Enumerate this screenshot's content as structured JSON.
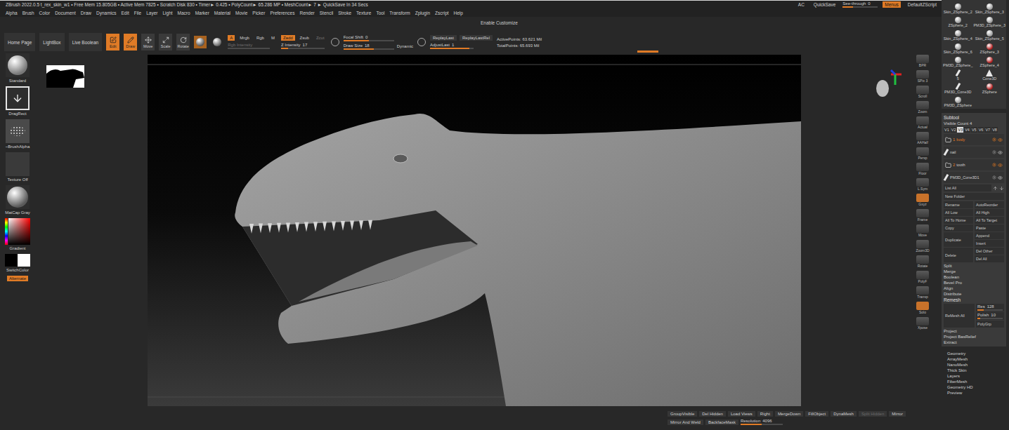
{
  "title_bar": {
    "text": "ZBrush 2022.0.5  t_rex_skin_w1  • Free Mem 15.805GB • Active Mem 7825 • Scratch Disk 830 • Timer► 0.425 • PolyCount► 65.286 MP • MeshCount► 7 ► QuickSave In 34 Secs"
  },
  "quick_bar": {
    "ac": "AC",
    "quicksave": "QuickSave",
    "see_through": {
      "label": "See-through",
      "value": "0",
      "level": 0.3
    },
    "menus": {
      "label": "Menus",
      "selected": true
    },
    "script": "DefaultZScript"
  },
  "menu": [
    "Alpha",
    "Brush",
    "Color",
    "Document",
    "Draw",
    "Dynamics",
    "Edit",
    "File",
    "Layer",
    "Light",
    "Macro",
    "Marker",
    "Material",
    "Movie",
    "Picker",
    "Preferences",
    "Render",
    "Stencil",
    "Stroke",
    "Texture",
    "Tool",
    "Transform",
    "Zplugin",
    "Zscript",
    "Help"
  ],
  "customize": "Enable Customize",
  "top_shelf": {
    "nav": [
      "Home Page",
      "LightBox",
      "Live Boolean"
    ],
    "modes": [
      {
        "label": "Edit",
        "selected": true
      },
      {
        "label": "Draw",
        "selected": true
      },
      {
        "label": "Move",
        "selected": false
      },
      {
        "label": "Scale",
        "selected": false
      },
      {
        "label": "Rotate",
        "selected": false
      }
    ],
    "color_modes": [
      {
        "label": "A",
        "selected": true
      },
      {
        "label": "Mrgb",
        "selected": false
      },
      {
        "label": "Rgb",
        "selected": false
      },
      {
        "label": "M",
        "selected": false
      }
    ],
    "rgb_intensity": {
      "label": "Rgb Intensity",
      "value": "",
      "level": 0,
      "disabled": true
    },
    "z_modes": [
      {
        "label": "Zadd",
        "selected": true,
        "disabled": false
      },
      {
        "label": "Zsub",
        "selected": false,
        "disabled": false
      },
      {
        "label": "Zcut",
        "selected": false,
        "disabled": true
      }
    ],
    "z_intensity": {
      "label": "Z Intensity",
      "value": "17",
      "level": 0.17
    },
    "focal_shift": {
      "label": "Focal Shift",
      "value": "0",
      "level": 0.5
    },
    "draw_size": {
      "label": "Draw Size",
      "value": "18",
      "level": 0.6
    },
    "dynamic": "Dynamic",
    "replay": [
      "ReplayLast",
      "ReplayLastRel"
    ],
    "adjust_last": {
      "label": "AdjustLast",
      "value": "1",
      "level": 0.9
    },
    "points": [
      "ActivePoints: 63.621 Mil",
      "TotalPoints: 65.693 Mil"
    ]
  },
  "left_shelf": [
    {
      "label": "Standard",
      "kind": "brush"
    },
    {
      "label": "DragRect",
      "kind": "stroke"
    },
    {
      "label": "~BrushAlpha",
      "kind": "alpha"
    },
    {
      "label": "Texture Off",
      "kind": "texture"
    },
    {
      "label": "MatCap Gray",
      "kind": "material"
    }
  ],
  "color": {
    "gradient": "Gradient",
    "switch": "SwitchColor",
    "alternate": {
      "label": "Alternate",
      "selected": true
    }
  },
  "right_shelf": [
    {
      "label": "BPR",
      "selected": false
    },
    {
      "label": "SPix 3",
      "selected": false
    },
    {
      "label": "Scroll",
      "selected": false
    },
    {
      "label": "Zoom",
      "selected": false
    },
    {
      "label": "Actual",
      "selected": false
    },
    {
      "label": "AAHalf",
      "selected": false
    },
    {
      "label": "Persp",
      "selected": false
    },
    {
      "label": "Floor",
      "selected": false
    },
    {
      "label": "L.Sym",
      "selected": false
    },
    {
      "label": "Gxyz",
      "selected": true
    },
    {
      "label": "Frame",
      "selected": false
    },
    {
      "label": "Move",
      "selected": false
    },
    {
      "label": "Zoom3D",
      "selected": false
    },
    {
      "label": "Rotate",
      "selected": false
    },
    {
      "label": "PolyF",
      "selected": false
    },
    {
      "label": "Transp",
      "selected": false
    },
    {
      "label": "Solo",
      "selected": true
    },
    {
      "label": "Xpose",
      "selected": false
    }
  ],
  "tools": [
    {
      "label": "Skin_ZSphere_2",
      "kind": "sphere"
    },
    {
      "label": "Skin_ZSphere_3",
      "kind": "sphere"
    },
    {
      "label": "ZSphere_2",
      "kind": "sphere"
    },
    {
      "label": "PM3D_ZSphere_3",
      "kind": "sphere"
    },
    {
      "label": "Skin_ZSphere_4",
      "kind": "sphere"
    },
    {
      "label": "Skin_ZSphere_5",
      "kind": "sphere"
    },
    {
      "label": "Skin_ZSphere_6",
      "kind": "sphere"
    },
    {
      "label": "ZSphere_3",
      "kind": "zsphere"
    },
    {
      "label": "PM3D_ZSphere_",
      "kind": "sphere"
    },
    {
      "label": "ZSphere_4",
      "kind": "zsphere"
    },
    {
      "label": "5",
      "kind": "stick"
    },
    {
      "label": "Cone3D",
      "kind": "cone"
    },
    {
      "label": "PM3D_Cone3D",
      "kind": "stick"
    },
    {
      "label": "ZSphere",
      "kind": "zsphere"
    },
    {
      "label": "PM3D_ZSphere",
      "kind": "sphere"
    }
  ],
  "subtool": {
    "title": "Subtool",
    "visible_count": "Visible Count 4",
    "versions": [
      {
        "label": "V1",
        "selected": false
      },
      {
        "label": "V2",
        "selected": false
      },
      {
        "label": "V3",
        "selected": true
      },
      {
        "label": "V4",
        "selected": false
      },
      {
        "label": "V5",
        "selected": false
      },
      {
        "label": "V6",
        "selected": false
      },
      {
        "label": "V7",
        "selected": false
      },
      {
        "label": "V8",
        "selected": false
      }
    ],
    "items": [
      {
        "kind": "folder",
        "index": "1",
        "label": "body",
        "selected": true
      },
      {
        "kind": "tool",
        "index": "",
        "label": "nail",
        "selected": false
      },
      {
        "kind": "folder",
        "index": "2",
        "label": "tooth",
        "selected": false
      },
      {
        "kind": "tool",
        "index": "",
        "label": "PM3D_Cone3D1",
        "selected": false
      }
    ],
    "list_all": "List All",
    "new_folder": "New Folder",
    "left_actions": [
      {
        "label": "Rename",
        "tall": false
      },
      {
        "label": "All Low",
        "tall": false
      },
      {
        "label": "All To Home",
        "tall": false
      },
      {
        "label": "Copy",
        "tall": false
      },
      {
        "label": "Duplicate",
        "tall": true
      },
      {
        "label": "Delete",
        "tall": true
      }
    ],
    "right_actions": [
      "AutoReorder",
      "All High",
      "All To Target",
      "Paste",
      "Append",
      "Insert",
      "Del Other",
      "Del All"
    ],
    "tools": [
      "Split",
      "Merge",
      "Boolean",
      "Bevel Pro",
      "Align",
      "Distribute"
    ],
    "remesh": {
      "title": "Remesh",
      "button": "ReMesh All",
      "res": {
        "label": "Res",
        "value": "128",
        "level": 0.25
      },
      "polish": {
        "label": "Polish",
        "value": "10",
        "level": 0.1
      },
      "polygrp": "PolyGrp"
    },
    "project": [
      "Project",
      "Project BasRelief",
      "Extract"
    ]
  },
  "palettes": [
    "Geometry",
    "ArrayMesh",
    "NanoMesh",
    "Thick Skin",
    "Layers",
    "FiberMesh",
    "Geometry HD",
    "Preview"
  ],
  "bottom_bar": {
    "row1": [
      {
        "label": "GroupVisible",
        "disabled": false
      },
      {
        "label": "Del Hidden",
        "disabled": false
      },
      {
        "label": "Load Views",
        "disabled": false
      },
      {
        "label": "Right",
        "disabled": false
      },
      {
        "label": "MergeDown",
        "disabled": false
      },
      {
        "label": "FillObject",
        "disabled": false
      },
      {
        "label": "DynaMesh",
        "disabled": false
      },
      {
        "label": "Split Hidden",
        "disabled": true
      },
      {
        "label": "Mirror",
        "disabled": false
      }
    ],
    "row2": [
      {
        "label": "Mirror And Weld",
        "disabled": false
      },
      {
        "label": "BackfaceMask",
        "disabled": false
      }
    ],
    "resolution": {
      "label": "Resolution",
      "value": "4096",
      "level": 0.5
    }
  }
}
